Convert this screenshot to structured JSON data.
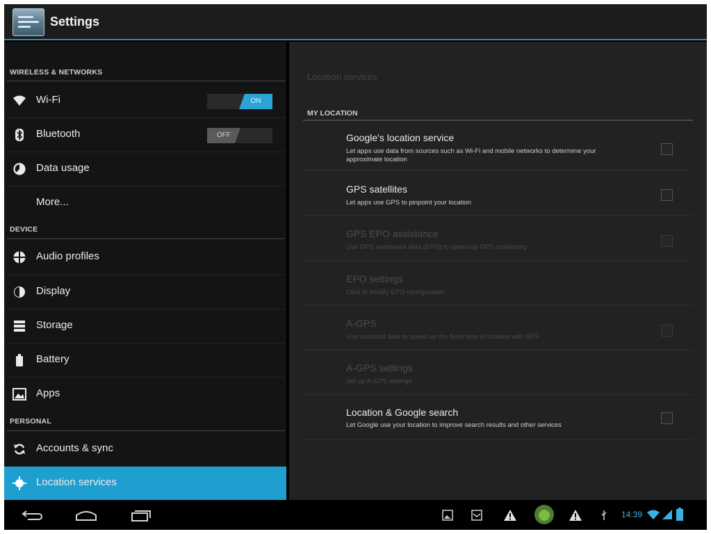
{
  "app": {
    "title": "Settings"
  },
  "sidebar": {
    "categories": {
      "wireless": "WIRELESS & NETWORKS",
      "device": "DEVICE",
      "personal": "PERSONAL"
    },
    "items": [
      {
        "label": "Wi-Fi",
        "icon": "wifi-icon",
        "toggle": "ON"
      },
      {
        "label": "Bluetooth",
        "icon": "bluetooth-icon",
        "toggle": "OFF"
      },
      {
        "label": "Data usage",
        "icon": "data-usage-icon"
      },
      {
        "label": "More..."
      },
      {
        "label": "Audio profiles",
        "icon": "audio-profiles-icon"
      },
      {
        "label": "Display",
        "icon": "display-icon"
      },
      {
        "label": "Storage",
        "icon": "storage-icon"
      },
      {
        "label": "Battery",
        "icon": "battery-icon"
      },
      {
        "label": "Apps",
        "icon": "apps-icon"
      },
      {
        "label": "Accounts & sync",
        "icon": "sync-icon"
      },
      {
        "label": "Location services",
        "icon": "location-icon",
        "selected": true
      }
    ]
  },
  "main": {
    "title": "Location services",
    "category": "MY LOCATION",
    "prefs": [
      {
        "title": "Google's location service",
        "summary": "Let apps use data from sources such as Wi-Fi and mobile networks to determine your approximate location",
        "enabled": true,
        "checked": false
      },
      {
        "title": "GPS satellites",
        "summary": "Let apps use GPS to pinpoint your location",
        "enabled": true,
        "checked": false
      },
      {
        "title": "GPS EPO assistance",
        "summary": "Use GPS assistance data (EPO) to speed up GPS positioning",
        "enabled": false,
        "checked": false
      },
      {
        "title": "EPO settings",
        "summary": "Click to modify EPO configuration",
        "enabled": false
      },
      {
        "title": "A-GPS",
        "summary": "Use assistant data to speed up the fixed time of location with GPS",
        "enabled": false,
        "checked": false
      },
      {
        "title": "A-GPS settings",
        "summary": "Set up A-GPS settings",
        "enabled": false
      },
      {
        "title": "Location & Google search",
        "summary": "Let Google use your location to improve search results and other services",
        "enabled": true,
        "checked": false
      }
    ]
  },
  "statusbar": {
    "time": "14:39"
  },
  "colors": {
    "accent": "#1e9fd0",
    "toggle_on": "#2aa4d6",
    "background": "#141414",
    "panel": "#222222"
  }
}
